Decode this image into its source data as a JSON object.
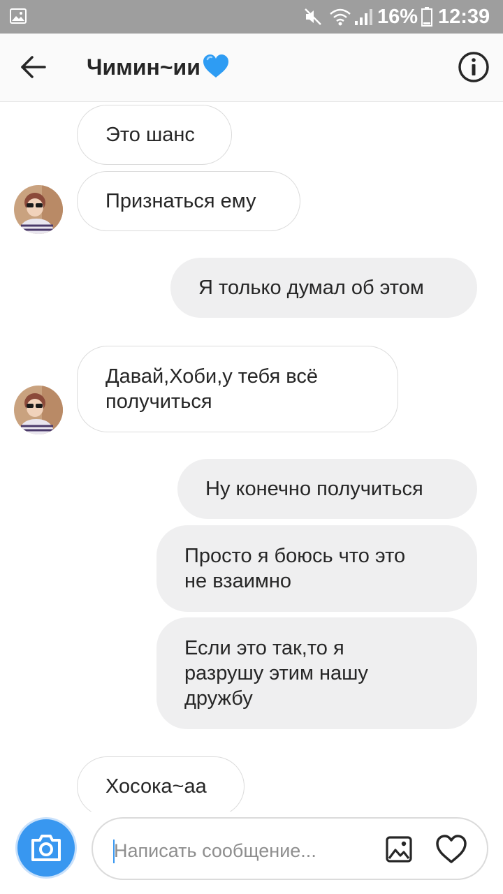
{
  "status_bar": {
    "battery_percent": "16%",
    "time": "12:39",
    "icons": [
      "gallery-notification-icon",
      "mute-icon",
      "wifi-icon",
      "signal-icon",
      "battery-icon"
    ]
  },
  "header": {
    "back_icon": "arrow-left-icon",
    "title": "Чимин~ии",
    "title_emoji": "blue-heart-emoji",
    "info_icon": "info-circle-icon"
  },
  "messages": [
    {
      "side": "in",
      "text": "Это шанс"
    },
    {
      "side": "in",
      "text": "Признаться ему",
      "avatar": true
    },
    {
      "side": "out",
      "text": "Я только думал об этом"
    },
    {
      "side": "in",
      "lines": [
        "Давай,Хоби,у тебя всё",
        "получиться"
      ],
      "avatar": true
    },
    {
      "side": "out",
      "text": "Ну конечно получиться"
    },
    {
      "side": "out",
      "lines": [
        "Просто я боюсь что это",
        "не взаимно"
      ]
    },
    {
      "side": "out",
      "lines": [
        "Если это так,то я",
        "разрушу этим нашу",
        "дружбу"
      ]
    },
    {
      "side": "in",
      "text": "Хосока~аа"
    }
  ],
  "composer": {
    "placeholder": "Написать сообщение...",
    "value": "",
    "camera_icon": "camera-icon",
    "gallery_icon": "image-icon",
    "like_icon": "heart-outline-icon"
  },
  "colors": {
    "accent": "#3897f0",
    "outgoing_bubble": "#efeff0",
    "incoming_border": "#dbdbdb",
    "status_bar": "#9e9e9e"
  }
}
